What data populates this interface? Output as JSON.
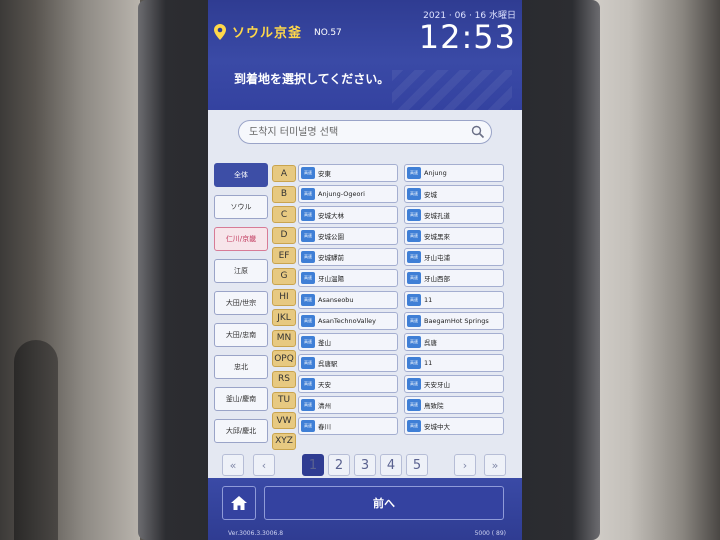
{
  "header": {
    "location_name": "ソウル京釜",
    "location_no": "NO.57",
    "date": "2021 · 06 · 16 水曜日",
    "time": "12:53",
    "instruction": "到着地を選択してください。"
  },
  "search": {
    "placeholder": "도착지 터미널명 선택"
  },
  "categories": [
    {
      "label": "全体",
      "state": "active"
    },
    {
      "label": "ソウル",
      "state": "normal"
    },
    {
      "label": "仁川/京畿",
      "state": "pink"
    },
    {
      "label": "江原",
      "state": "normal"
    },
    {
      "label": "大田/世宗",
      "state": "normal"
    },
    {
      "label": "大田/忠南",
      "state": "normal"
    },
    {
      "label": "忠北",
      "state": "normal"
    },
    {
      "label": "釜山/慶南",
      "state": "normal"
    },
    {
      "label": "大邱/慶北",
      "state": "normal"
    }
  ],
  "letters": [
    "A",
    "B",
    "C",
    "D",
    "EF",
    "G",
    "HI",
    "JKL",
    "MN",
    "OPQ",
    "RS",
    "TU",
    "VW",
    "XYZ"
  ],
  "terminal_badge": "高速",
  "terminals_col1": [
    "安東",
    "Anjung-Ogeori",
    "安城大林",
    "安城公園",
    "安城驛前",
    "牙山温陽",
    "Asanseobu",
    "AsanTechnoValley",
    "釜山",
    "呉唐駅",
    "天安",
    "清州",
    "春川"
  ],
  "terminals_col2": [
    "Anjung",
    "安城",
    "安城孔道",
    "安城黑來",
    "牙山屯浦",
    "牙山西部",
    "11",
    "BaegamHot Springs",
    "呉唐",
    "11",
    "天安牙山",
    "鳥致院",
    "安城中大"
  ],
  "pager": {
    "first": "«",
    "prev": "‹",
    "pages": [
      "1",
      "2",
      "3",
      "4",
      "5"
    ],
    "current": "1",
    "next": "›",
    "last": "»"
  },
  "footer": {
    "back_label": "前へ",
    "version": "Ver.3006.3.3006.8",
    "count": "5000 (  89)"
  },
  "colors": {
    "header": "#2f3c92",
    "accent_yellow": "#ffd84a",
    "letter_bg": "#e7c981",
    "badge": "#3f7fd6"
  }
}
